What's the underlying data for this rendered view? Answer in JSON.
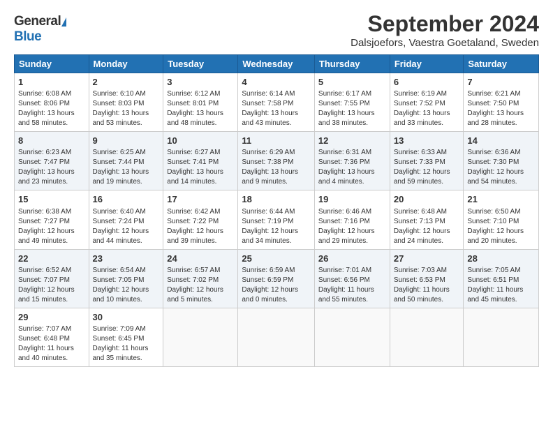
{
  "header": {
    "logo_general": "General",
    "logo_blue": "Blue",
    "title": "September 2024",
    "subtitle": "Dalsjoefors, Vaestra Goetaland, Sweden"
  },
  "calendar": {
    "days": [
      "Sunday",
      "Monday",
      "Tuesday",
      "Wednesday",
      "Thursday",
      "Friday",
      "Saturday"
    ],
    "weeks": [
      [
        {
          "day": 1,
          "sunrise": "6:08 AM",
          "sunset": "8:06 PM",
          "daylight": "13 hours and 58 minutes."
        },
        {
          "day": 2,
          "sunrise": "6:10 AM",
          "sunset": "8:03 PM",
          "daylight": "13 hours and 53 minutes."
        },
        {
          "day": 3,
          "sunrise": "6:12 AM",
          "sunset": "8:01 PM",
          "daylight": "13 hours and 48 minutes."
        },
        {
          "day": 4,
          "sunrise": "6:14 AM",
          "sunset": "7:58 PM",
          "daylight": "13 hours and 43 minutes."
        },
        {
          "day": 5,
          "sunrise": "6:17 AM",
          "sunset": "7:55 PM",
          "daylight": "13 hours and 38 minutes."
        },
        {
          "day": 6,
          "sunrise": "6:19 AM",
          "sunset": "7:52 PM",
          "daylight": "13 hours and 33 minutes."
        },
        {
          "day": 7,
          "sunrise": "6:21 AM",
          "sunset": "7:50 PM",
          "daylight": "13 hours and 28 minutes."
        }
      ],
      [
        {
          "day": 8,
          "sunrise": "6:23 AM",
          "sunset": "7:47 PM",
          "daylight": "13 hours and 23 minutes."
        },
        {
          "day": 9,
          "sunrise": "6:25 AM",
          "sunset": "7:44 PM",
          "daylight": "13 hours and 19 minutes."
        },
        {
          "day": 10,
          "sunrise": "6:27 AM",
          "sunset": "7:41 PM",
          "daylight": "13 hours and 14 minutes."
        },
        {
          "day": 11,
          "sunrise": "6:29 AM",
          "sunset": "7:38 PM",
          "daylight": "13 hours and 9 minutes."
        },
        {
          "day": 12,
          "sunrise": "6:31 AM",
          "sunset": "7:36 PM",
          "daylight": "13 hours and 4 minutes."
        },
        {
          "day": 13,
          "sunrise": "6:33 AM",
          "sunset": "7:33 PM",
          "daylight": "12 hours and 59 minutes."
        },
        {
          "day": 14,
          "sunrise": "6:36 AM",
          "sunset": "7:30 PM",
          "daylight": "12 hours and 54 minutes."
        }
      ],
      [
        {
          "day": 15,
          "sunrise": "6:38 AM",
          "sunset": "7:27 PM",
          "daylight": "12 hours and 49 minutes."
        },
        {
          "day": 16,
          "sunrise": "6:40 AM",
          "sunset": "7:24 PM",
          "daylight": "12 hours and 44 minutes."
        },
        {
          "day": 17,
          "sunrise": "6:42 AM",
          "sunset": "7:22 PM",
          "daylight": "12 hours and 39 minutes."
        },
        {
          "day": 18,
          "sunrise": "6:44 AM",
          "sunset": "7:19 PM",
          "daylight": "12 hours and 34 minutes."
        },
        {
          "day": 19,
          "sunrise": "6:46 AM",
          "sunset": "7:16 PM",
          "daylight": "12 hours and 29 minutes."
        },
        {
          "day": 20,
          "sunrise": "6:48 AM",
          "sunset": "7:13 PM",
          "daylight": "12 hours and 24 minutes."
        },
        {
          "day": 21,
          "sunrise": "6:50 AM",
          "sunset": "7:10 PM",
          "daylight": "12 hours and 20 minutes."
        }
      ],
      [
        {
          "day": 22,
          "sunrise": "6:52 AM",
          "sunset": "7:07 PM",
          "daylight": "12 hours and 15 minutes."
        },
        {
          "day": 23,
          "sunrise": "6:54 AM",
          "sunset": "7:05 PM",
          "daylight": "12 hours and 10 minutes."
        },
        {
          "day": 24,
          "sunrise": "6:57 AM",
          "sunset": "7:02 PM",
          "daylight": "12 hours and 5 minutes."
        },
        {
          "day": 25,
          "sunrise": "6:59 AM",
          "sunset": "6:59 PM",
          "daylight": "12 hours and 0 minutes."
        },
        {
          "day": 26,
          "sunrise": "7:01 AM",
          "sunset": "6:56 PM",
          "daylight": "11 hours and 55 minutes."
        },
        {
          "day": 27,
          "sunrise": "7:03 AM",
          "sunset": "6:53 PM",
          "daylight": "11 hours and 50 minutes."
        },
        {
          "day": 28,
          "sunrise": "7:05 AM",
          "sunset": "6:51 PM",
          "daylight": "11 hours and 45 minutes."
        }
      ],
      [
        {
          "day": 29,
          "sunrise": "7:07 AM",
          "sunset": "6:48 PM",
          "daylight": "11 hours and 40 minutes."
        },
        {
          "day": 30,
          "sunrise": "7:09 AM",
          "sunset": "6:45 PM",
          "daylight": "11 hours and 35 minutes."
        },
        null,
        null,
        null,
        null,
        null
      ]
    ]
  }
}
